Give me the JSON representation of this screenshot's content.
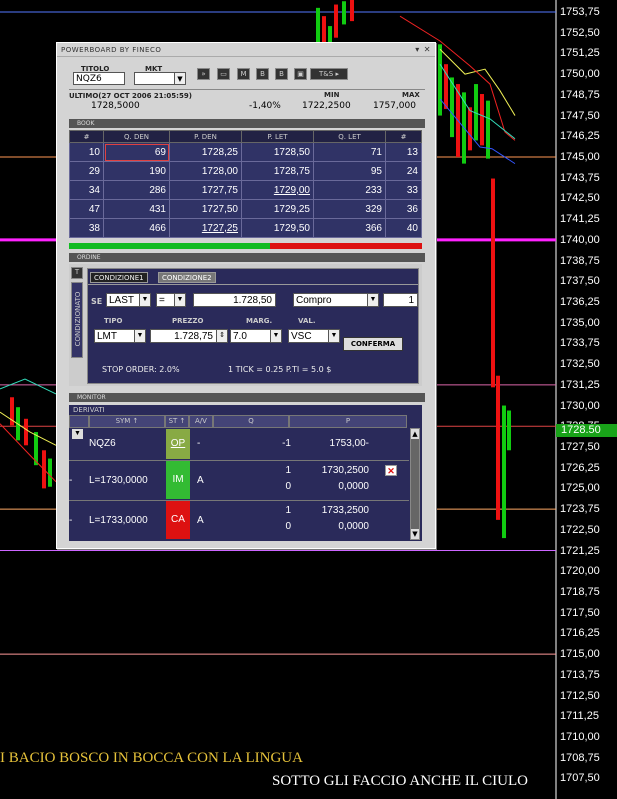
{
  "chart_data": {
    "type": "line",
    "ylim": [
      1706.5,
      1754.5
    ],
    "y_ticks": [
      "1753,75",
      "1752,50",
      "1751,25",
      "1750,00",
      "1748,75",
      "1747,50",
      "1746,25",
      "1745,00",
      "1743,75",
      "1742,50",
      "1741,25",
      "1740,00",
      "1738,75",
      "1737,50",
      "1736,25",
      "1735,00",
      "1733,75",
      "1732,50",
      "1731,25",
      "1730,00",
      "1728,75",
      "1727,50",
      "1726,25",
      "1725,00",
      "1723,75",
      "1722,50",
      "1721,25",
      "1720,00",
      "1718,75",
      "1717,50",
      "1716,25",
      "1715,00",
      "1713,75",
      "1712,50",
      "1711,25",
      "1710,00",
      "1708,75",
      "1707,50"
    ],
    "y_tick_values": [
      1753.75,
      1752.5,
      1751.25,
      1750,
      1748.75,
      1747.5,
      1746.25,
      1745,
      1743.75,
      1742.5,
      1741.25,
      1740,
      1738.75,
      1737.5,
      1736.25,
      1735,
      1733.75,
      1732.5,
      1731.25,
      1730,
      1728.75,
      1727.5,
      1726.25,
      1725,
      1723.75,
      1722.5,
      1721.25,
      1720,
      1718.75,
      1717.5,
      1716.25,
      1715,
      1713.75,
      1712.5,
      1711.25,
      1710,
      1708.75,
      1707.5
    ],
    "last_price_label": "1728.50",
    "last_price": 1728.5,
    "hlines": [
      {
        "y": 1753.75,
        "color": "#5577ff"
      },
      {
        "y": 1745.0,
        "color": "#ff9955"
      },
      {
        "y": 1740.0,
        "color": "#ff22ff"
      },
      {
        "y": 1731.25,
        "color": "#dd66aa"
      },
      {
        "y": 1728.75,
        "color": "#dd4444"
      },
      {
        "y": 1723.75,
        "color": "#ffaa66"
      },
      {
        "y": 1721.25,
        "color": "#cc66ff"
      },
      {
        "y": 1715.0,
        "color": "#ff9999"
      }
    ]
  },
  "captions": {
    "line1": "I BACIO BOSCO IN BOCCA CON LA LINGUA",
    "line2": "SOTTO GLI FACCIO ANCHE IL CIULO"
  },
  "panel": {
    "title": "POWERBOARD BY FINECO",
    "titolo_label": "TITOLO",
    "titolo_value": "NQZ6",
    "mkt_label": "MKT",
    "ts_label": "T&S",
    "ultimo_label": "ULTIMO(27 OCT 2006 21:05:59)",
    "ultimo_value": "1728,5000",
    "change": "-1,40%",
    "min_label": "MIN",
    "min_value": "1722,2500",
    "max_label": "MAX",
    "max_value": "1757,000",
    "book_label": "BOOK",
    "book_headers": [
      "#",
      "Q. DEN",
      "P. DEN",
      "P. LET",
      "Q. LET",
      "#"
    ],
    "book_rows": [
      [
        "10",
        "69",
        "1728,25",
        "1728,50",
        "71",
        "13"
      ],
      [
        "29",
        "190",
        "1728,00",
        "1728,75",
        "95",
        "24"
      ],
      [
        "34",
        "286",
        "1727,75",
        "1729,00",
        "233",
        "33"
      ],
      [
        "47",
        "431",
        "1727,50",
        "1729,25",
        "329",
        "36"
      ],
      [
        "38",
        "466",
        "1727,25",
        "1729,50",
        "366",
        "40"
      ]
    ],
    "bid_ratio": 0.57,
    "ordine_label": "ORDINE",
    "cond_tab_label": "CONDIZIONATO",
    "t_tab": "T",
    "cond1": "CONDIZIONE1",
    "cond2": "CONDIZIONE2",
    "se_label": "SE",
    "se_field": "LAST",
    "se_op": "=",
    "se_price": "1.728,50",
    "se_action": "Compro",
    "se_qty": "1",
    "tipo_label": "TIPO",
    "prezzo_label": "PREZZO",
    "marg_label": "MARG.",
    "val_label": "VAL.",
    "tipo_value": "LMT",
    "prezzo_value": "1.728,75",
    "marg_value": "7.0",
    "val_value": "VSC",
    "conferma_label": "CONFERMA",
    "stop_text": "STOP ORDER: 2.0%",
    "tick_text": "1   TICK = 0.25   P.TI = 5.0 $",
    "monitor_label": "MONITOR",
    "derivati_label": "DERIVATI",
    "monitor_headers": [
      "",
      "SYM ↑",
      "ST ↑",
      "A/V",
      "Q",
      "P"
    ],
    "monitor_rows": [
      {
        "sym": "NQZ6",
        "st": "OP",
        "av": "-",
        "q": "-1",
        "p": "1753,00-",
        "st_color": "#88aa44"
      },
      {
        "sym": "L=1730,0000",
        "st": "IM",
        "av": "A",
        "q": "1",
        "q2": "0",
        "p": "1730,2500",
        "p2": "0,0000",
        "st_color": "#33bb33"
      },
      {
        "sym": "L=1733,0000",
        "st": "CA",
        "av": "A",
        "q": "1",
        "q2": "0",
        "p": "1733,2500",
        "p2": "0,0000",
        "st_color": "#dd1111"
      }
    ]
  }
}
